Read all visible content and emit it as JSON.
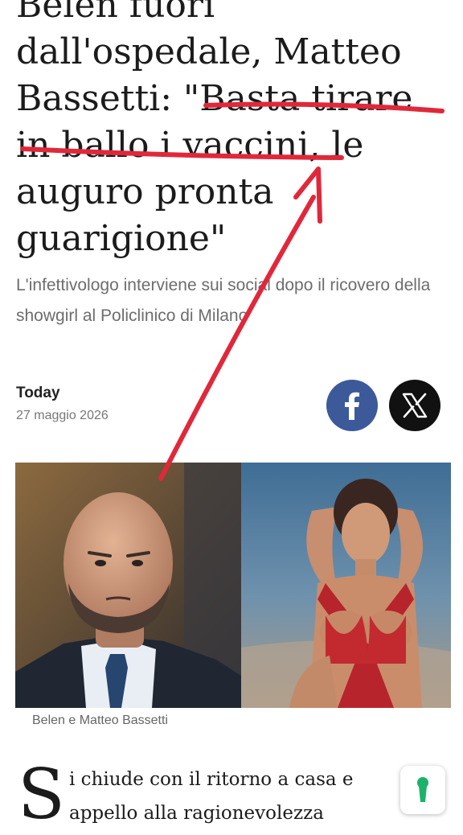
{
  "article": {
    "headline_lines": [
      "Belen fuori",
      "dall'ospedale, Matteo",
      "Bassetti: \"Basta tirare",
      "in ballo i vaccini, le",
      "auguro pronta",
      "guarigione\""
    ],
    "subtitle": "L'infettivologo interviene sui social dopo il ricovero della showgirl al Policlinico di Milano",
    "source": "Today",
    "date": "27 maggio 2026",
    "image_caption": "Belen e Matteo Bassetti",
    "dropcap": "S",
    "body_lines": [
      "i chiude con il ritorno a casa e",
      "appello alla ragionevolezza"
    ]
  },
  "share": {
    "facebook_icon": "facebook-icon",
    "x_icon": "x-logo-icon"
  },
  "colors": {
    "annotation_red": "#e0283a",
    "facebook_blue": "#3c5a99",
    "scroll_button_accent": "#1db26b"
  }
}
